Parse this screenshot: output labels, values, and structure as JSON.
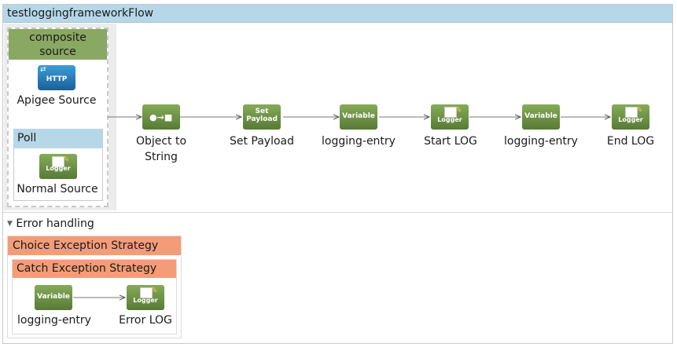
{
  "flow": {
    "title": "testloggingframeworkFlow"
  },
  "sources": {
    "composite_header": "composite\nsource",
    "http_icon_text": "HTTP",
    "http_label": "Apigee Source",
    "poll_header": "Poll",
    "logger_label": "Normal Source"
  },
  "icons": {
    "logger": "Logger",
    "variable": "Variable",
    "set_payload": "Set\nPayload"
  },
  "processors": [
    {
      "label": "Object to\nString"
    },
    {
      "label": "Set Payload"
    },
    {
      "label": "logging-entry"
    },
    {
      "label": "Start LOG"
    },
    {
      "label": "logging-entry"
    },
    {
      "label": "End LOG"
    }
  ],
  "error_handling": {
    "title": "Error handling",
    "choice": "Choice Exception Strategy",
    "catch": "Catch Exception Strategy",
    "steps": [
      {
        "label": "logging-entry"
      },
      {
        "label": "Error LOG"
      }
    ]
  },
  "colors": {
    "header_blue": "#b6d7e8",
    "processor_green": "#6f9444",
    "exception_orange": "#f49c78"
  }
}
